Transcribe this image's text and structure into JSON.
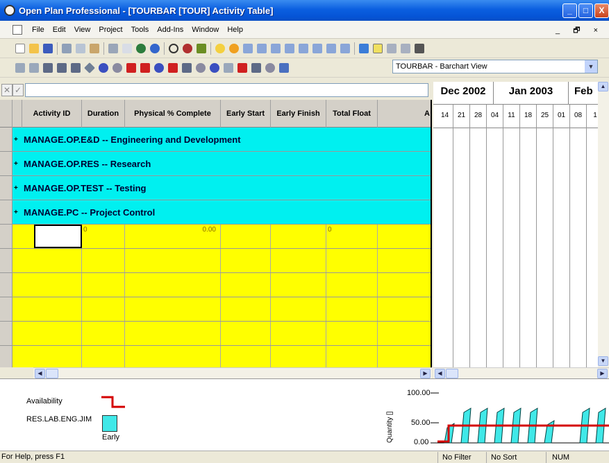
{
  "window": {
    "title": "Open Plan Professional - [TOURBAR [TOUR]  Activity Table]",
    "controls": [
      "_",
      "□",
      "X"
    ]
  },
  "menu": {
    "items": [
      "File",
      "Edit",
      "View",
      "Project",
      "Tools",
      "Add-Ins",
      "Window",
      "Help"
    ],
    "mdi_controls": "_ 🗗 ×"
  },
  "toolbar": {
    "view_select": "TOURBAR - Barchart View"
  },
  "edit_bar": {
    "cancel": "✕",
    "confirm": "✓",
    "value": ""
  },
  "table": {
    "columns": [
      "Activity ID",
      "Duration",
      "Physical % Complete",
      "Early Start",
      "Early Finish",
      "Total Float",
      "A"
    ],
    "summary_rows": [
      {
        "expander": "+",
        "label": "MANAGE.OP.E&D -- Engineering and Development"
      },
      {
        "expander": "+",
        "label": "MANAGE.OP.RES -- Research"
      },
      {
        "expander": "+",
        "label": "MANAGE.OP.TEST -- Testing"
      },
      {
        "expander": "+",
        "label": "MANAGE.PC -- Project Control"
      }
    ],
    "new_row": {
      "duration": "0",
      "physical_pct": "0.00",
      "total_float": "0"
    }
  },
  "gantt": {
    "months": [
      "Dec 2002",
      "Jan 2003",
      "Feb"
    ],
    "weeks": [
      "14",
      "21",
      "28",
      "04",
      "11",
      "18",
      "25",
      "01",
      "08",
      "1"
    ]
  },
  "resource_chart": {
    "legend": {
      "availability_label": "Availability",
      "resource_label": "RES.LAB.ENG.JIM",
      "early_label": "Early"
    },
    "y_axis_label": "Quantity []",
    "y_ticks": [
      "100.00",
      "50.00",
      "0.00"
    ],
    "availability_color": "#d40000",
    "bar_color": "#40e8e8"
  },
  "status_bar": {
    "help_text": "For Help, press F1",
    "filter": "No Filter",
    "sort": "No Sort",
    "num": "NUM"
  }
}
